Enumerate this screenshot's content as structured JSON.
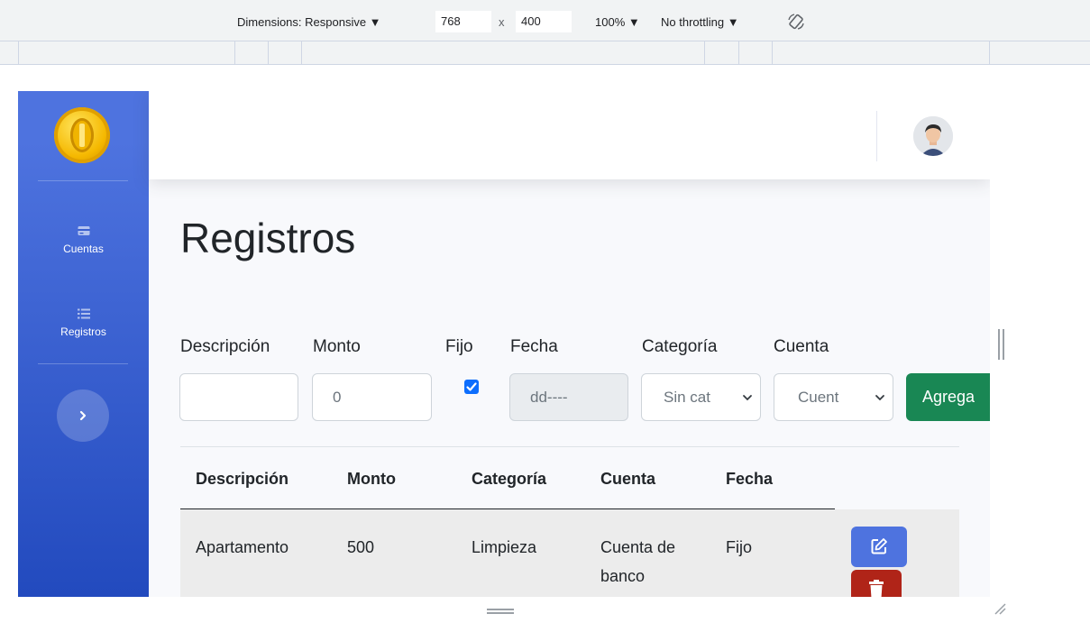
{
  "devtools": {
    "dimensions_label": "Dimensions: Responsive ▼",
    "width_value": "768",
    "times": "x",
    "height_value": "400",
    "zoom_label": "100% ▼",
    "throttling_label": "No throttling ▼",
    "rotate_icon": "rotate-icon"
  },
  "sidebar": {
    "logo": "coin-logo",
    "items": [
      {
        "label": "Cuentas",
        "icon": "card-icon"
      },
      {
        "label": "Registros",
        "icon": "list-icon"
      }
    ],
    "toggle_icon": "chevron-right-icon"
  },
  "topbar": {
    "avatar": "user-avatar"
  },
  "page": {
    "title": "Registros"
  },
  "form": {
    "labels": {
      "descripcion": "Descripción",
      "monto": "Monto",
      "fijo": "Fijo",
      "fecha": "Fecha",
      "categoria": "Categoría",
      "cuenta": "Cuenta"
    },
    "descripcion_value": "",
    "monto_value": "0",
    "fijo_checked": true,
    "fecha_placeholder": "dd----",
    "categoria_selected": "Sin cat",
    "cuenta_selected": "Cuent",
    "add_button": "Agrega"
  },
  "table": {
    "headers": [
      "Descripción",
      "Monto",
      "Categoría",
      "Cuenta",
      "Fecha"
    ],
    "rows": [
      {
        "descripcion": "Apartamento",
        "monto": "500",
        "categoria": "Limpieza",
        "cuenta_line1": "Cuenta de",
        "cuenta_line2": "banco",
        "fecha": "Fijo"
      }
    ]
  },
  "colors": {
    "sidebar_top": "#4e73df",
    "sidebar_bottom": "#224abe",
    "add_button": "#198754",
    "edit_button": "#4e73df",
    "delete_button": "#b02418"
  }
}
